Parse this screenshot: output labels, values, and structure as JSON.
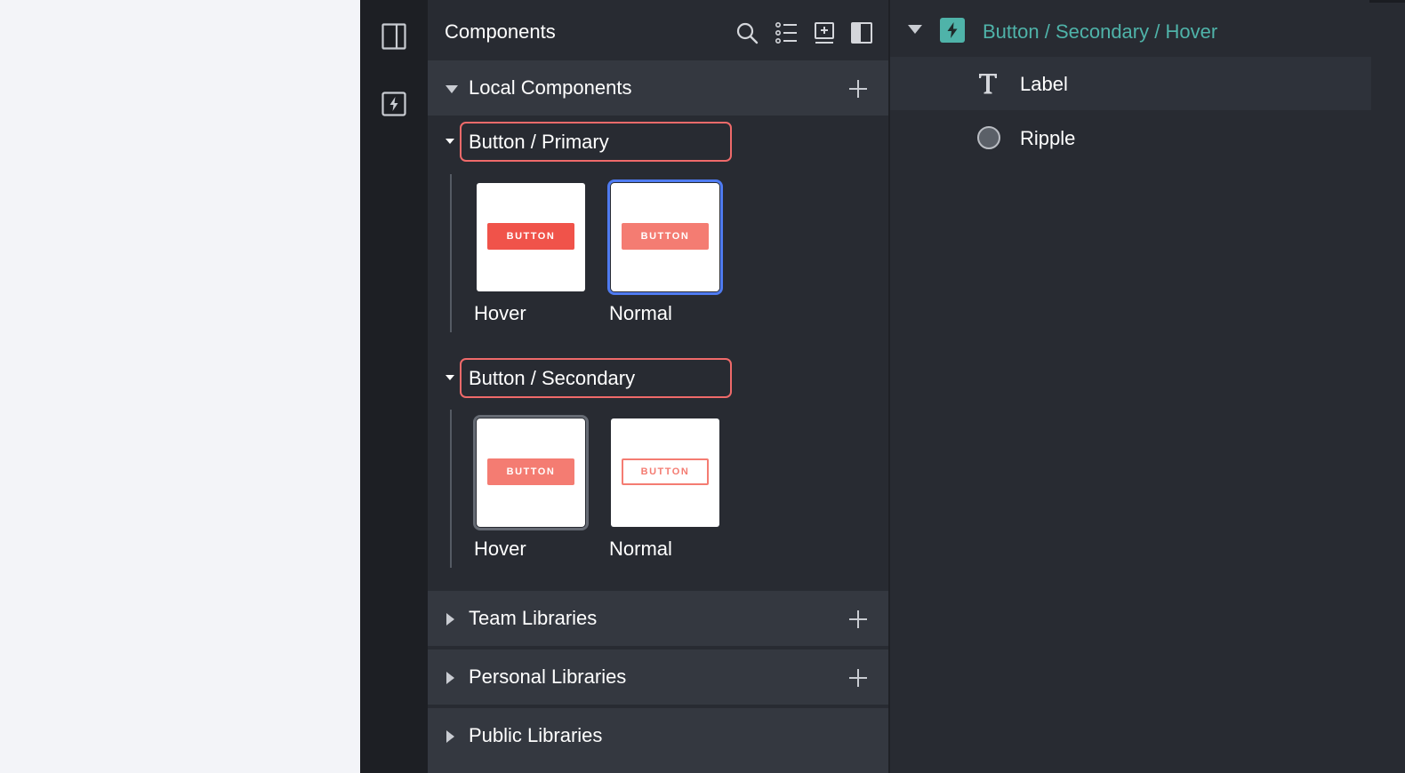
{
  "panel": {
    "title": "Components",
    "tools": [
      "search-icon",
      "list-icon",
      "insert-icon",
      "sidebar-toggle-icon"
    ]
  },
  "sections": {
    "local": {
      "label": "Local Components",
      "expanded": true
    },
    "team": {
      "label": "Team Libraries",
      "expanded": false
    },
    "personal": {
      "label": "Personal Libraries",
      "expanded": false
    },
    "public": {
      "label": "Public Libraries",
      "expanded": false
    }
  },
  "groups": [
    {
      "label": "Button / Primary",
      "items": [
        {
          "caption": "Hover",
          "preview_text": "BUTTON"
        },
        {
          "caption": "Normal",
          "preview_text": "BUTTON"
        }
      ]
    },
    {
      "label": "Button / Secondary",
      "items": [
        {
          "caption": "Hover",
          "preview_text": "BUTTON"
        },
        {
          "caption": "Normal",
          "preview_text": "BUTTON"
        }
      ]
    }
  ],
  "layers": {
    "title": "Button / Secondary / Hover",
    "items": [
      {
        "label": "Label",
        "icon": "text-icon"
      },
      {
        "label": "Ripple",
        "icon": "circle-icon"
      }
    ]
  },
  "colors": {
    "accent_teal": "#4fb3a9",
    "highlight_red": "#ef6a6a",
    "selection_blue": "#4f7bf1",
    "button_red": "#f0534a"
  }
}
